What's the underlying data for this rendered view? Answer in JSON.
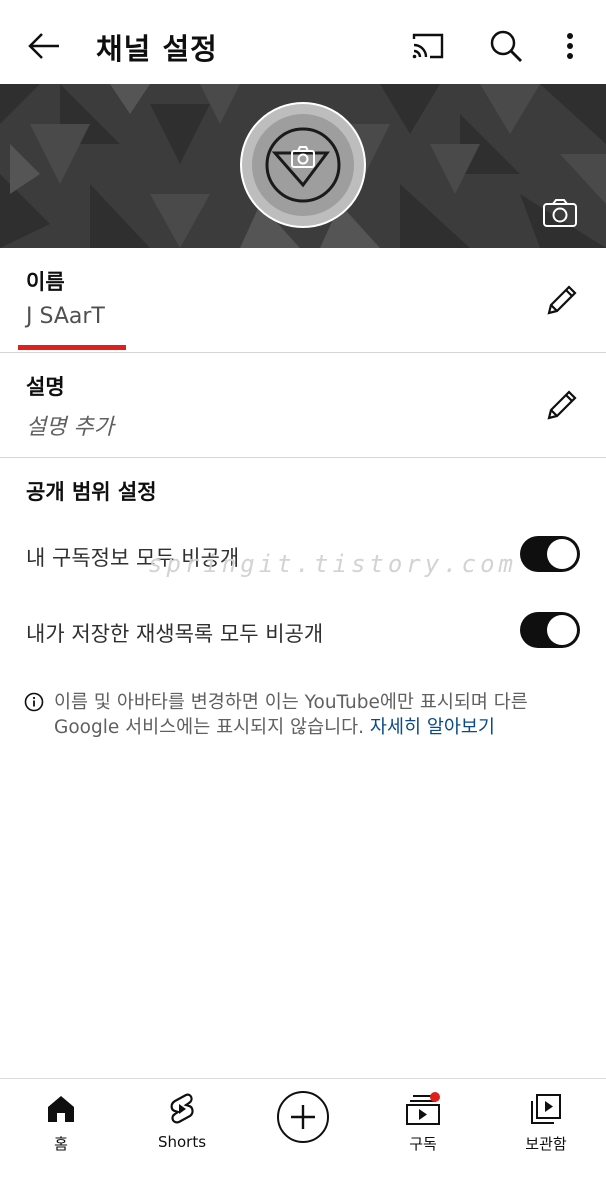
{
  "header": {
    "title": "채널 설정",
    "back_icon": "arrow-left-icon",
    "cast_icon": "cast-icon",
    "search_icon": "search-icon",
    "more_icon": "more-vertical-icon"
  },
  "banner": {
    "camera_icon": "camera-icon",
    "avatar_icon": "avatar-camera-icon"
  },
  "name_field": {
    "label": "이름",
    "value": "J SAarT"
  },
  "description_field": {
    "label": "설명",
    "placeholder": "설명 추가"
  },
  "privacy": {
    "title": "공개 범위 설정",
    "toggles": [
      {
        "label": "내 구독정보 모두 비공개",
        "on": true
      },
      {
        "label": "내가 저장한 재생목록 모두 비공개",
        "on": true
      }
    ]
  },
  "info": {
    "text": "이름 및 아바타를 변경하면 이는 YouTube에만 표시되며 다른 Google 서비스에는 표시되지 않습니다.",
    "link": "자세히 알아보기"
  },
  "watermark": "springit.tistory.com",
  "bottom_nav": {
    "home": "홈",
    "shorts": "Shorts",
    "subscriptions": "구독",
    "library": "보관함"
  },
  "colors": {
    "accent_red": "#e0201c",
    "link_blue": "#0b4a8a",
    "toggle_on": "#0f0f0f"
  }
}
